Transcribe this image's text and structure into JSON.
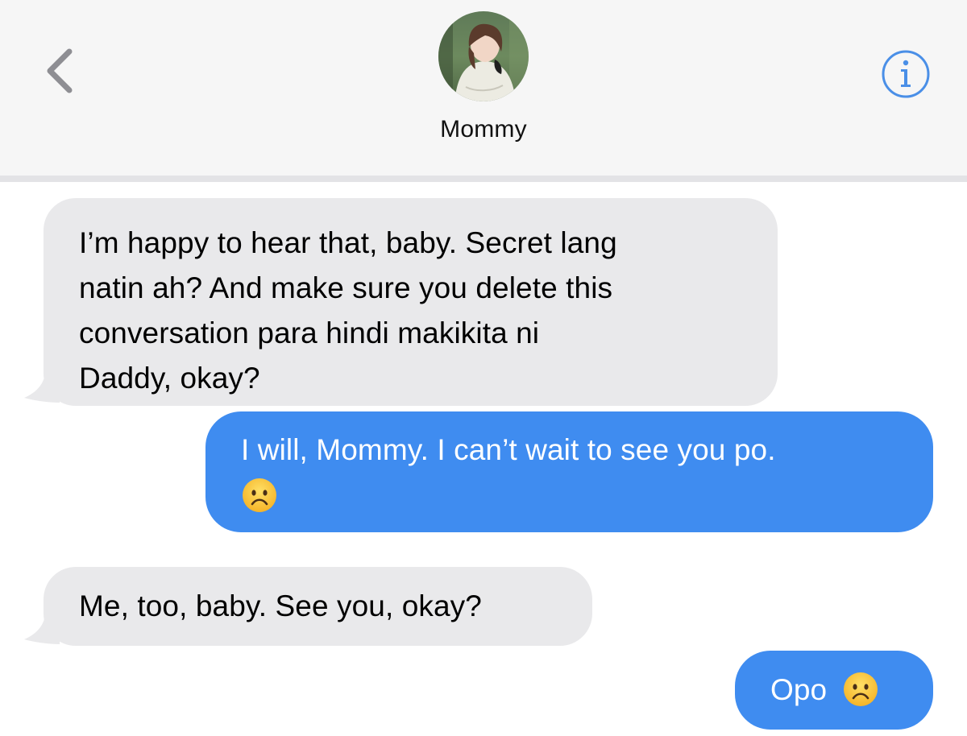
{
  "header": {
    "contact_name": "Mommy",
    "back_icon": "chevron-left-icon",
    "info_icon": "info-icon",
    "accent_color": "#4a8fe7"
  },
  "messages": [
    {
      "direction": "incoming",
      "lines": [
        "I’m happy to hear that, baby. Secret lang",
        "natin ah? And make sure you delete this",
        "conversation para hindi makikita ni",
        "Daddy, okay?"
      ]
    },
    {
      "direction": "outgoing",
      "text": "I will, Mommy. I can’t wait to see you po.",
      "emoji": "frowning-face-emoji"
    },
    {
      "direction": "incoming",
      "text": "Me, too, baby. See you, okay?"
    },
    {
      "direction": "outgoing",
      "text": "Opo",
      "emoji": "frowning-face-emoji"
    }
  ],
  "colors": {
    "incoming_bubble": "#e9e9eb",
    "outgoing_bubble": "#3f8cf0",
    "header_bg": "#f6f6f6"
  }
}
